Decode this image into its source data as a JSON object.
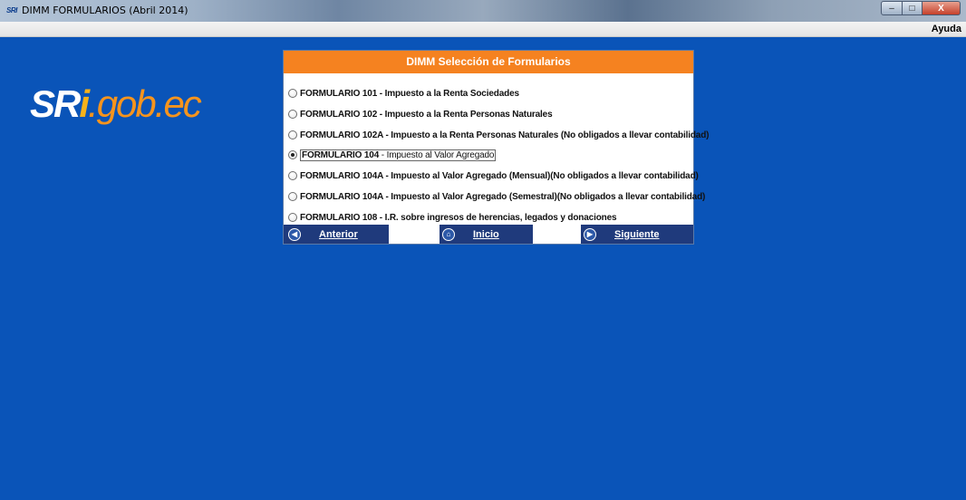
{
  "window": {
    "icon_text": "SRI",
    "title": "DIMM FORMULARIOS (Abril 2014)",
    "controls": {
      "minimize": "–",
      "maximize": "□",
      "close": "X"
    }
  },
  "menu": {
    "help": "Ayuda"
  },
  "logo": {
    "part1": "SR",
    "part2": "i",
    "part3": ".gob.ec"
  },
  "dialog": {
    "title": "DIMM Selección de Formularios",
    "options": [
      {
        "code": "FORMULARIO 101",
        "desc": " - Impuesto a la Renta  Sociedades",
        "selected": false
      },
      {
        "code": "FORMULARIO 102",
        "desc": " - Impuesto a la Renta  Personas Naturales",
        "selected": false
      },
      {
        "code": "FORMULARIO 102A",
        "desc": " - Impuesto a la Renta  Personas Naturales (No obligados a llevar contabilidad)",
        "selected": false
      },
      {
        "code": "FORMULARIO 104",
        "desc": " - Impuesto al Valor Agregado",
        "selected": true
      },
      {
        "code": "FORMULARIO 104A",
        "desc": " - Impuesto al Valor Agregado (Mensual)(No obligados a llevar contabilidad)",
        "selected": false
      },
      {
        "code": "FORMULARIO 104A",
        "desc": " - Impuesto al Valor Agregado (Semestral)(No obligados a llevar contabilidad)",
        "selected": false
      },
      {
        "code": "FORMULARIO 108",
        "desc": " - I.R. sobre ingresos de herencias, legados y donaciones",
        "selected": false
      }
    ],
    "nav": {
      "prev": "Anterior",
      "home": "Inicio",
      "next": "Siguiente"
    }
  }
}
